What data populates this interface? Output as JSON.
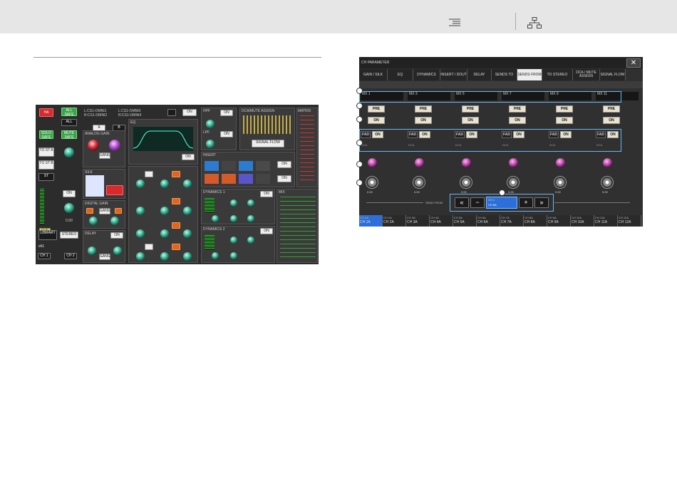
{
  "left_screen": {
    "buttons": {
      "red_top": "HA",
      "all_safe": "ALL SAFE",
      "all": "ALL",
      "solo_safe": "SOLO SAFE",
      "mute_safe": "MUTE SAFE",
      "to_st_a": "TO ST A",
      "to_st_b": "TO ST B",
      "st": "ST",
      "on": "ON",
      "cue": "CUE A+B",
      "library": "LIBRARY",
      "stereo": "STEREO",
      "gang": "GANG",
      "signal_flow": "SIGNAL FLOW",
      "patch": "PATCH"
    },
    "headers": {
      "hpf": "HPF",
      "lpf": "LPF",
      "dca_mute": "DCA/MUTE ASSIGN",
      "matrix": "MATRIX",
      "mix": "MIX",
      "analog_gain": "ANALOG GAIN",
      "silk": "SILK",
      "digital_gain": "DIGITAL GAIN",
      "delay": "DELAY",
      "eq": "EQ",
      "insert": "INSERT",
      "dynamics1": "DYNAMICS 1",
      "dynamics2": "DYNAMICS 2"
    },
    "ports": {
      "a": "L:CS1-OMNI1\nR:CS1-OMNI2",
      "b": "L:CS1-OMNI3\nR:CS1-OMNI4"
    },
    "fader_value": "0.00",
    "channel_name": "ch1",
    "ch1": "CH 1",
    "ch2": "CH 2",
    "ab": {
      "a": "A",
      "b": "B"
    }
  },
  "right_screen": {
    "window_title": "CH PARAMETER",
    "close_glyph": "✕",
    "tabs": [
      {
        "label": "GAIN / SILK",
        "active": false
      },
      {
        "label": "EQ",
        "active": false
      },
      {
        "label": "DYNAMICS",
        "active": false
      },
      {
        "label": "INSERT / DOUT",
        "active": false
      },
      {
        "label": "DELAY",
        "active": false
      },
      {
        "label": "SENDS TO",
        "active": false
      },
      {
        "label": "SENDS FROM",
        "active": true
      },
      {
        "label": "TO STEREO",
        "active": false
      },
      {
        "label": "DCA / MUTE ASSIGN",
        "active": false
      },
      {
        "label": "SIGNAL FLOW",
        "active": false
      }
    ],
    "columns": [
      {
        "mix": "MX 1",
        "pre": "PRE",
        "on": "ON",
        "fad": "FAD",
        "on2": "ON",
        "dca": "DCA",
        "level": "0.00"
      },
      {
        "mix": "MX 3",
        "pre": "PRE",
        "on": "ON",
        "fad": "FAD",
        "on2": "ON",
        "dca": "DCA",
        "level": "0.00"
      },
      {
        "mix": "MX 5",
        "pre": "PRE",
        "on": "ON",
        "fad": "FAD",
        "on2": "ON",
        "dca": "DCA",
        "level": "0.00"
      },
      {
        "mix": "MX 7",
        "pre": "PRE",
        "on": "ON",
        "fad": "FAD",
        "on2": "ON",
        "dca": "DCA",
        "level": "0.00"
      },
      {
        "mix": "MX 9",
        "pre": "PRE",
        "on": "ON",
        "fad": "FAD",
        "on2": "ON",
        "dca": "DCA",
        "level": "0.00"
      },
      {
        "mix": "MX 11",
        "pre": "PRE",
        "on": "ON",
        "fad": "FAD",
        "on2": "ON",
        "dca": "DCA",
        "level": "0.00"
      }
    ],
    "send_from_label": "SEND FROM",
    "nav": {
      "first": "«",
      "minus": "−",
      "current_top": "CH 1",
      "current_bottom": "CH 6A",
      "plus": "+",
      "last": "»"
    },
    "channels": [
      {
        "top": "CH 1A",
        "bottom": "CH 1A",
        "selected": true
      },
      {
        "top": "CH 2A",
        "bottom": "CH 2A",
        "selected": false
      },
      {
        "top": "CH 3A",
        "bottom": "CH 3A",
        "selected": false
      },
      {
        "top": "CH 4A",
        "bottom": "CH 4A",
        "selected": false
      },
      {
        "top": "CH 5A",
        "bottom": "CH 5A",
        "selected": false
      },
      {
        "top": "CH 6A",
        "bottom": "CH 6A",
        "selected": false
      },
      {
        "top": "CH 7A",
        "bottom": "CH 7A",
        "selected": false
      },
      {
        "top": "CH 8A",
        "bottom": "CH 8A",
        "selected": false
      },
      {
        "top": "CH 9A",
        "bottom": "CH 9A",
        "selected": false
      },
      {
        "top": "CH 10A",
        "bottom": "CH 10A",
        "selected": false
      },
      {
        "top": "CH 11A",
        "bottom": "CH 11A",
        "selected": false
      },
      {
        "top": "CH 12A",
        "bottom": "CH 12A",
        "selected": false
      }
    ]
  }
}
